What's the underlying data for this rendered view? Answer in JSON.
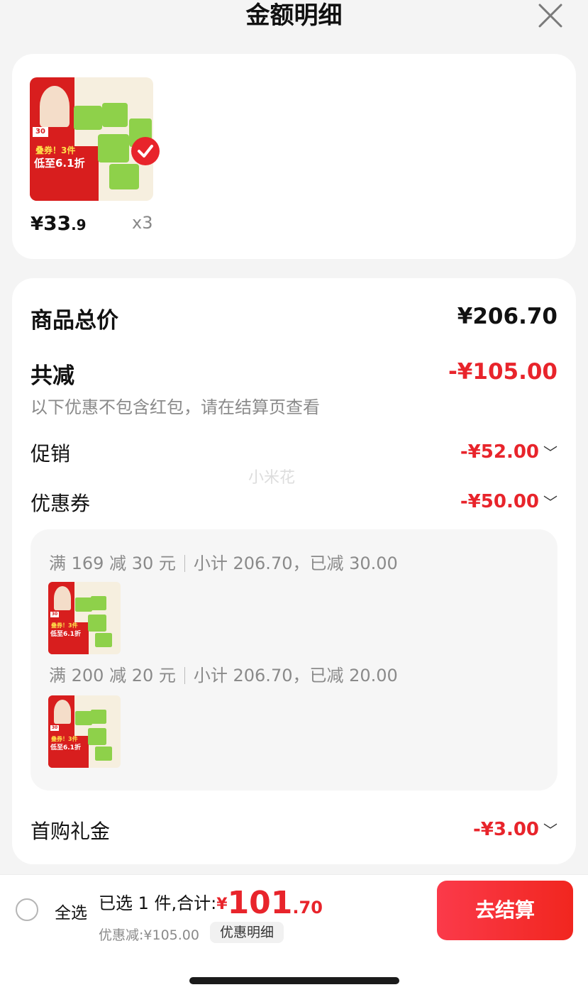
{
  "header": {
    "title": "金额明细",
    "close_icon": "close-icon"
  },
  "product": {
    "price_currency": "¥",
    "price_int": "33",
    "price_dec": ".9",
    "quantity": "x3",
    "selected": true
  },
  "summary_card": {
    "total_label": "商品总价",
    "total_value": "¥206.70",
    "reduce_label": "共减",
    "reduce_value": "-¥105.00",
    "reduce_note": "以下优惠不包含红包，请在结算页查看",
    "promo_label": "促销",
    "promo_value": "-¥52.00",
    "coupon_label": "优惠券",
    "coupon_value": "-¥50.00",
    "coupons": [
      {
        "rule": "满 169 减 30 元",
        "detail": "小计 206.70，已减 30.00"
      },
      {
        "rule": "满 200 减 20 元",
        "detail": "小计 206.70，已减 20.00"
      }
    ],
    "gift_label": "首购礼金",
    "gift_value": "-¥3.00"
  },
  "watermark": "小米花",
  "thumb": {
    "badge": "30",
    "line1": "叠券！3件",
    "line2": "低至6.1折"
  },
  "bottom_bar": {
    "select_all": "全选",
    "selected_text": "已选 1 件,合计:",
    "total_currency": "¥",
    "total_int": "101",
    "total_dec": ".70",
    "discount_text": "优惠减:¥105.00",
    "detail_button": "优惠明细",
    "checkout_button": "去结算"
  },
  "colors": {
    "accent": "#e8242b",
    "background": "#f4f4f4",
    "card": "#ffffff"
  }
}
